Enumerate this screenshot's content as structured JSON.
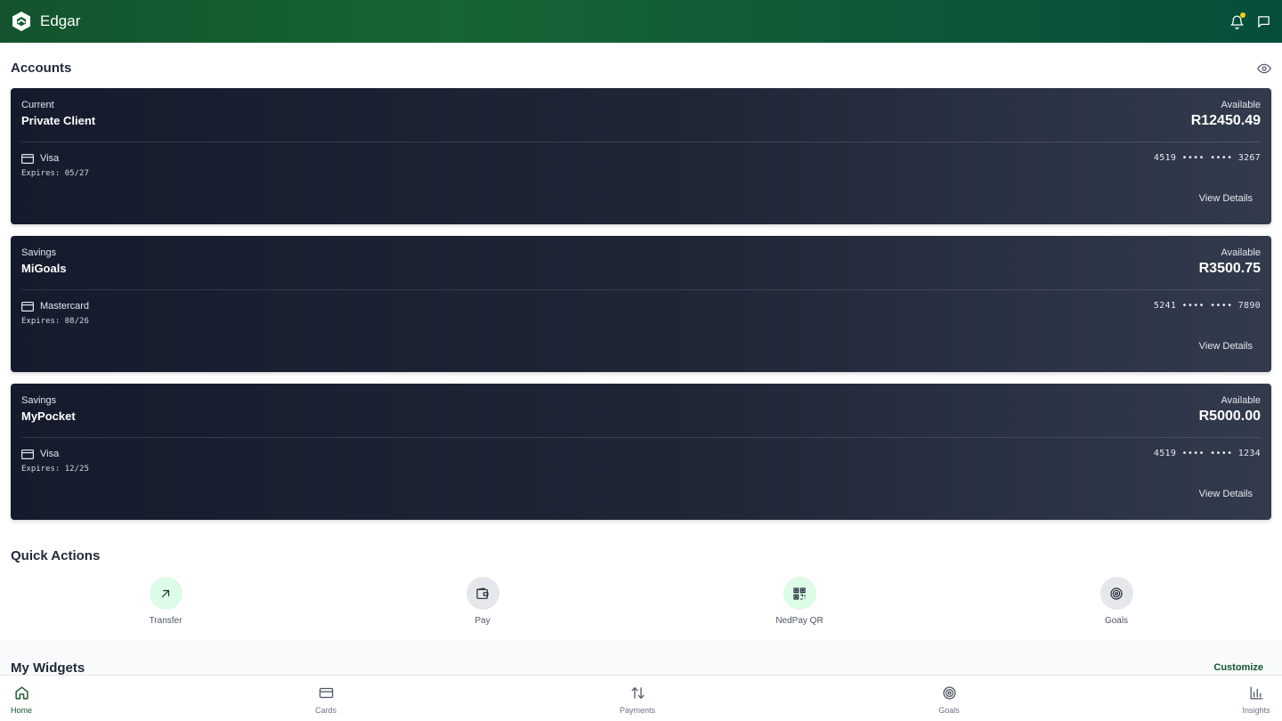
{
  "app": {
    "name": "Edgar"
  },
  "header": {
    "icons": [
      "logo-icon",
      "bell-icon",
      "chat-icon"
    ]
  },
  "accounts": {
    "title": "Accounts",
    "items": [
      {
        "type": "Current",
        "name": "Private Client",
        "available_label": "Available",
        "available": "R12450.49",
        "card_brand": "Visa",
        "expiry": "Expires: 05/27",
        "card_number": "4519 •••• •••• 3267",
        "action": "View Details"
      },
      {
        "type": "Savings",
        "name": "MiGoals",
        "available_label": "Available",
        "available": "R3500.75",
        "card_brand": "Mastercard",
        "expiry": "Expires: 08/26",
        "card_number": "5241 •••• •••• 7890",
        "action": "View Details"
      },
      {
        "type": "Savings",
        "name": "MyPocket",
        "available_label": "Available",
        "available": "R5000.00",
        "card_brand": "Visa",
        "expiry": "Expires: 12/25",
        "card_number": "4519 •••• •••• 1234",
        "action": "View Details"
      }
    ]
  },
  "quick_actions": {
    "title": "Quick Actions",
    "items": [
      {
        "label": "Transfer",
        "icon": "arrow-up-right-icon"
      },
      {
        "label": "Pay",
        "icon": "wallet-icon"
      },
      {
        "label": "NedPay QR",
        "icon": "qr-code-icon"
      },
      {
        "label": "Goals",
        "icon": "target-icon"
      }
    ]
  },
  "widgets": {
    "title": "My Widgets",
    "customize": "Customize"
  },
  "nav": {
    "items": [
      {
        "label": "Home",
        "icon": "home-icon",
        "active": true
      },
      {
        "label": "Cards",
        "icon": "card-icon",
        "active": false
      },
      {
        "label": "Payments",
        "icon": "transfer-arrows-icon",
        "active": false
      },
      {
        "label": "Goals",
        "icon": "target-icon",
        "active": false
      },
      {
        "label": "Insights",
        "icon": "bar-chart-icon",
        "active": false
      }
    ]
  },
  "colors": {
    "brand": "#14532d",
    "header_end": "#064e3b",
    "notification": "#facc15",
    "card_dark": "#151b2c"
  }
}
